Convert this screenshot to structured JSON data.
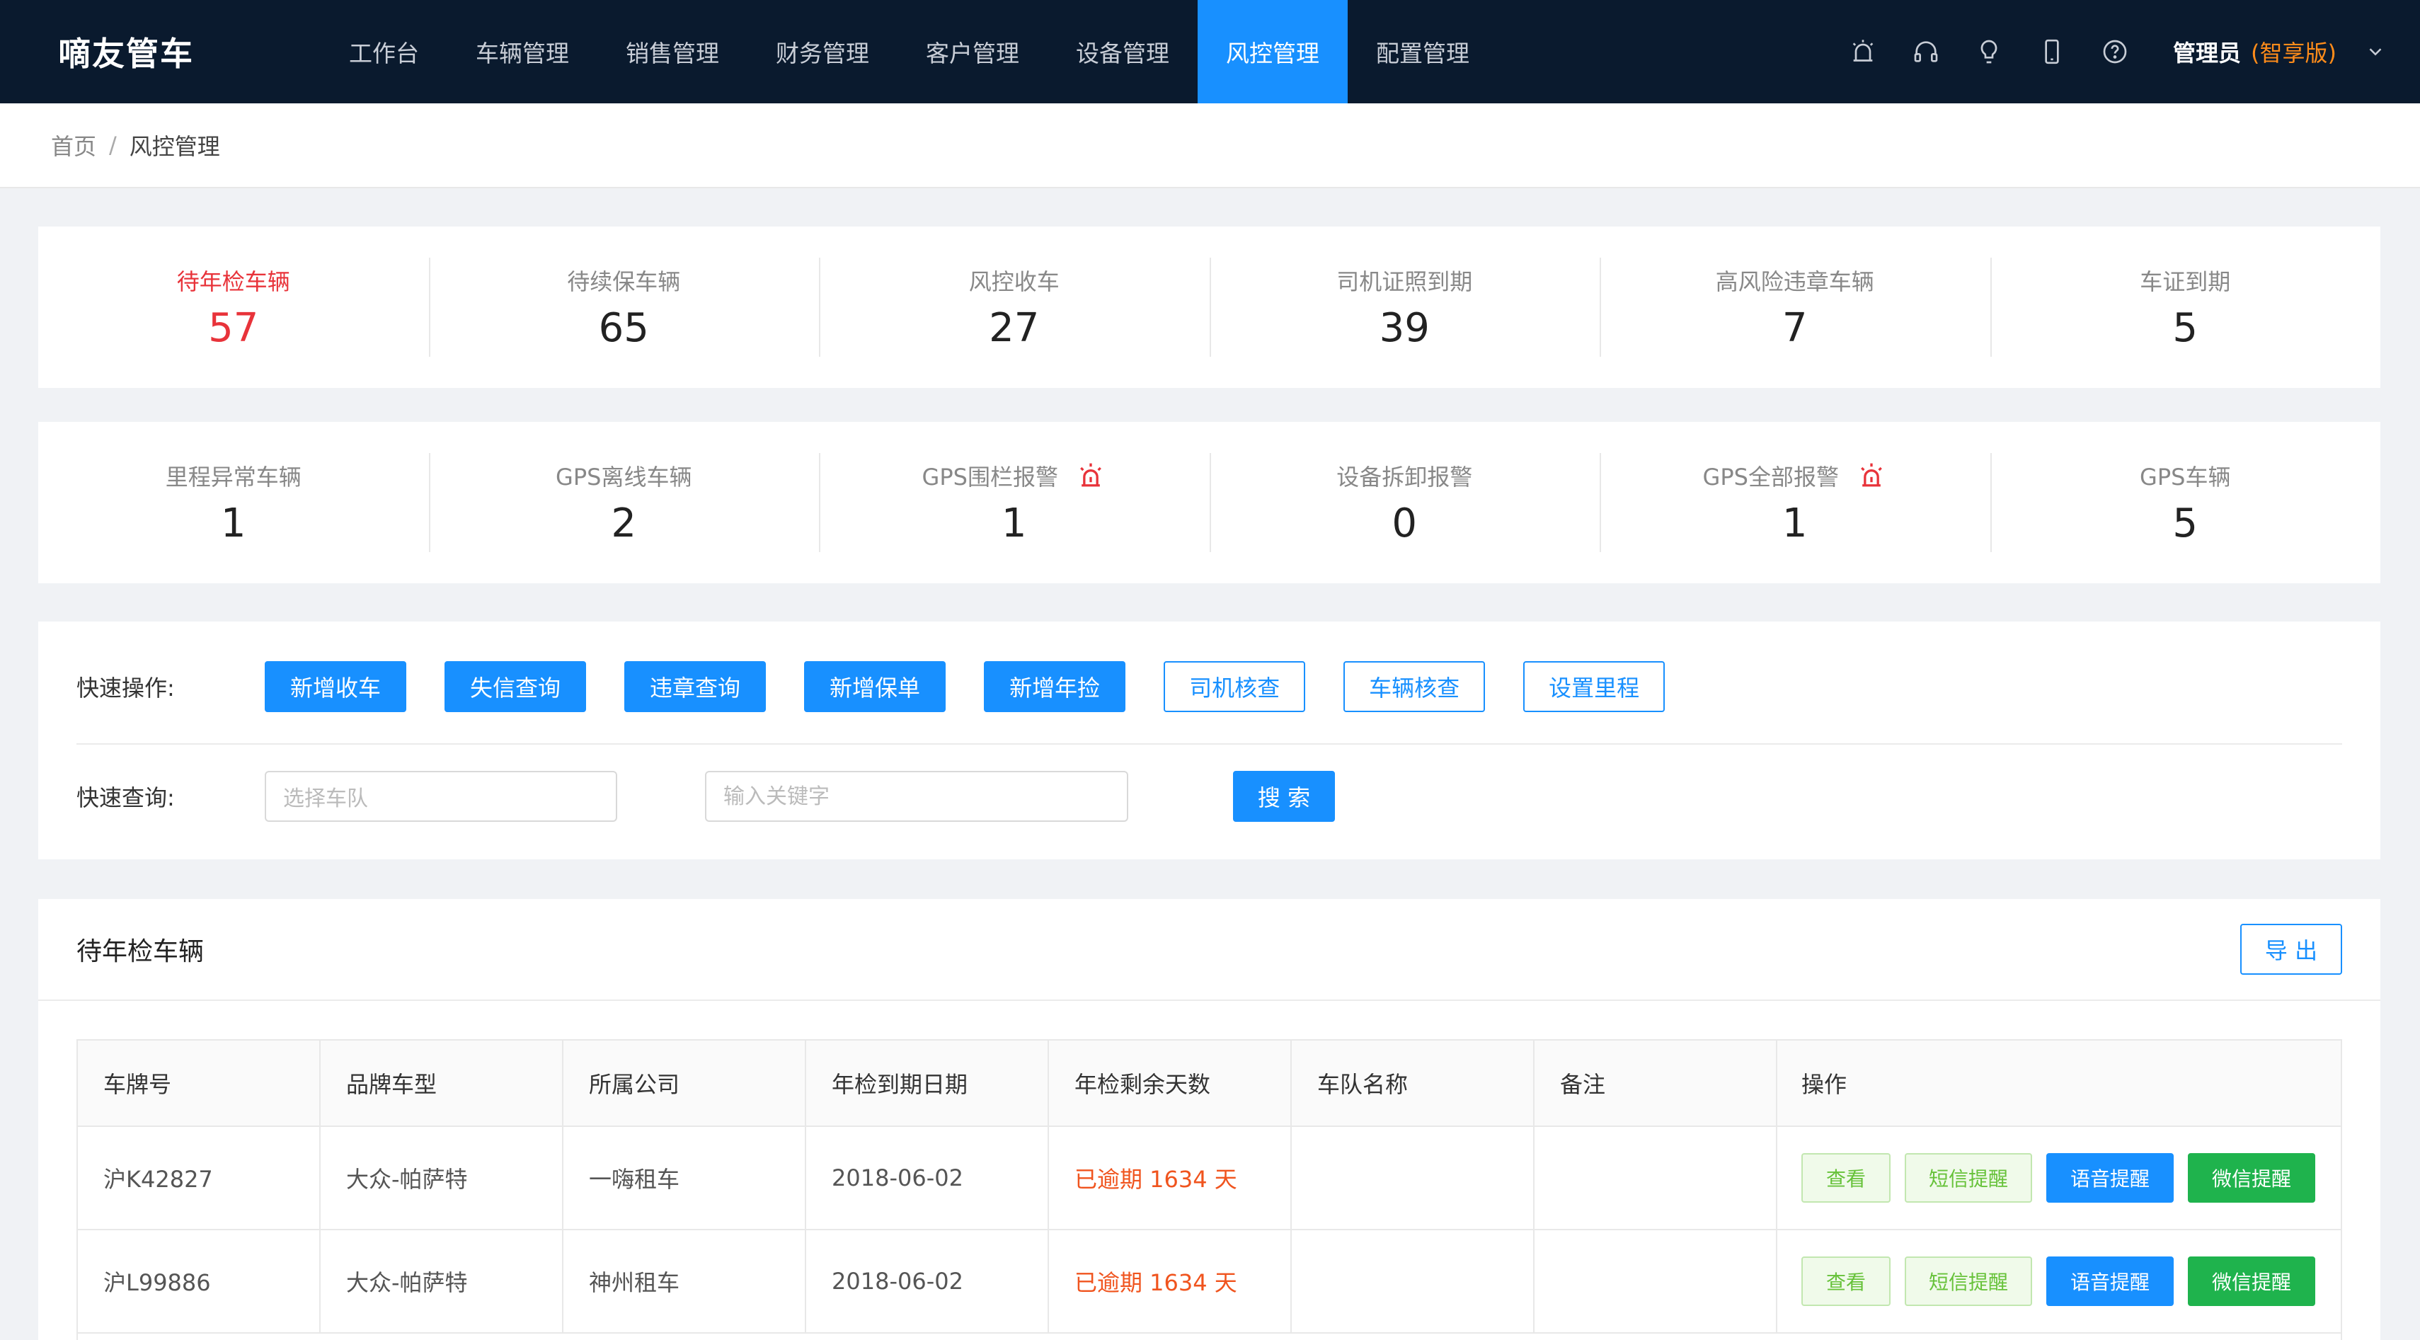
{
  "app": {
    "logo": "嘀友管车"
  },
  "nav": {
    "items": [
      {
        "label": "工作台"
      },
      {
        "label": "车辆管理"
      },
      {
        "label": "销售管理"
      },
      {
        "label": "财务管理"
      },
      {
        "label": "客户管理"
      },
      {
        "label": "设备管理"
      },
      {
        "label": "风控管理"
      },
      {
        "label": "配置管理"
      }
    ],
    "active": "风控管理",
    "icons": [
      "alarm-icon",
      "headset-icon",
      "lightbulb-icon",
      "mobile-icon",
      "help-icon"
    ],
    "user": {
      "name": "管理员",
      "edition": "(智享版)"
    }
  },
  "breadcrumb": {
    "home": "首页",
    "separator": "/",
    "current": "风控管理"
  },
  "stats": {
    "row1": [
      {
        "label": "待年检车辆",
        "value": "57",
        "highlight": true
      },
      {
        "label": "待续保车辆",
        "value": "65"
      },
      {
        "label": "风控收车",
        "value": "27"
      },
      {
        "label": "司机证照到期",
        "value": "39"
      },
      {
        "label": "高风险违章车辆",
        "value": "7"
      },
      {
        "label": "车证到期",
        "value": "5"
      }
    ],
    "row2": [
      {
        "label": "里程异常车辆",
        "value": "1"
      },
      {
        "label": "GPS离线车辆",
        "value": "2"
      },
      {
        "label": "GPS围栏报警",
        "value": "1",
        "alarm": true
      },
      {
        "label": "设备拆卸报警",
        "value": "0"
      },
      {
        "label": "GPS全部报警",
        "value": "1",
        "alarm": true
      },
      {
        "label": "GPS车辆",
        "value": "5"
      }
    ]
  },
  "quick_ops": {
    "label": "快速操作:",
    "solid_buttons": [
      "新增收车",
      "失信查询",
      "违章查询",
      "新增保单",
      "新增年捡"
    ],
    "outline_buttons": [
      "司机核查",
      "车辆核查",
      "设置里程"
    ]
  },
  "quick_query": {
    "label": "快速查询:",
    "fleet_placeholder": "选择车队",
    "keyword_placeholder": "输入关键字",
    "search_label": "搜 索"
  },
  "panel": {
    "title": "待年检车辆",
    "export_label": "导 出",
    "columns": [
      "车牌号",
      "品牌车型",
      "所属公司",
      "年检到期日期",
      "年检剩余天数",
      "车队名称",
      "备注",
      "操作"
    ],
    "rows": [
      {
        "plate": "沪K42827",
        "model": "大众-帕萨特",
        "company": "一嗨租车",
        "due": "2018-06-02",
        "remaining": "已逾期 1634 天",
        "fleet": "",
        "note": ""
      },
      {
        "plate": "沪L99886",
        "model": "大众-帕萨特",
        "company": "神州租车",
        "due": "2018-06-02",
        "remaining": "已逾期 1634 天",
        "fleet": "",
        "note": ""
      }
    ],
    "actions": {
      "view": "查看",
      "sms": "短信提醒",
      "voice": "语音提醒",
      "wechat": "微信提醒"
    }
  },
  "colors": {
    "nav_bg": "#0a1a2e",
    "accent": "#1890ff",
    "highlight_red": "#e8333a",
    "overdue_orange": "#f0541e",
    "edition_orange": "#ff8c1a",
    "wechat_green": "#1fb34d"
  }
}
